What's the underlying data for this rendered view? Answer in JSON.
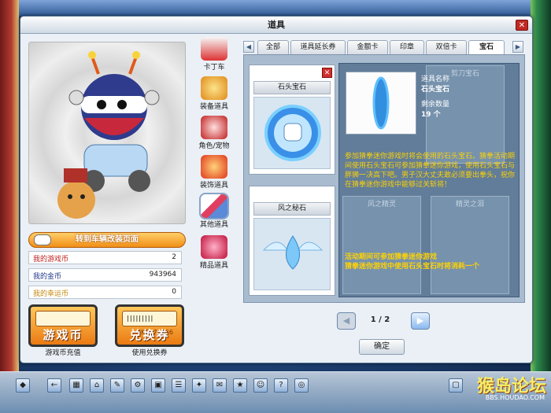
{
  "window": {
    "title": "道具"
  },
  "left": {
    "goto_label": "转到车辆改装页面",
    "stats": [
      {
        "label": "我的游戏币",
        "value": "2",
        "color": "#c02020"
      },
      {
        "label": "我的金币",
        "value": "943964",
        "color": "#1e3a8a"
      },
      {
        "label": "我的幸运币",
        "value": "0",
        "color": "#c58a10"
      }
    ],
    "game_coin_btn": "游戏币",
    "game_coin_caption": "游戏币充值",
    "voucher_btn": "兑换券",
    "voucher_barcode": "0K5874256",
    "voucher_caption": "使用兑换券"
  },
  "categories": [
    {
      "label": "卡丁车",
      "icon": "kart-icon"
    },
    {
      "label": "装备道具",
      "icon": "equipment-icon"
    },
    {
      "label": "角色/宠物",
      "icon": "character-pet-icon"
    },
    {
      "label": "装饰道具",
      "icon": "decoration-icon"
    },
    {
      "label": "其他道具",
      "icon": "other-items-icon"
    },
    {
      "label": "精品道具",
      "icon": "premium-items-icon"
    }
  ],
  "tabs": [
    "全部",
    "道具延长券",
    "金额卡",
    "印章",
    "双倍卡",
    "宝石"
  ],
  "active_tab": "宝石",
  "items": [
    {
      "name": "石头宝石"
    },
    {
      "name": "风之秘石"
    }
  ],
  "ghost_items": [
    "剪刀宝石",
    "风之精灵",
    "精灵之泪"
  ],
  "detail": {
    "name_label": "道具名称",
    "name": "石头宝石",
    "qty_label": "剩余数量",
    "qty": "19 个",
    "desc": "参加猜拳迷你游戏时将会使用的石头宝石。猜拳活动期间使用石头宝石可参加猜拳迷你游戏，使用石头宝石与胖狮一决高下吧。男子汉大丈夫敢必须要出拳头，祝你在猜拳迷你游戏中能够过关斩将！",
    "hint": "活动期间可参加猜拳迷你游戏\n猜拳迷你游戏中使用石头宝石时将消耗一个"
  },
  "pager": {
    "text": "1 / 2"
  },
  "ok_label": "确定",
  "watermark": {
    "title": "猴岛论坛",
    "url": "BBS.HOUDAO.COM"
  }
}
